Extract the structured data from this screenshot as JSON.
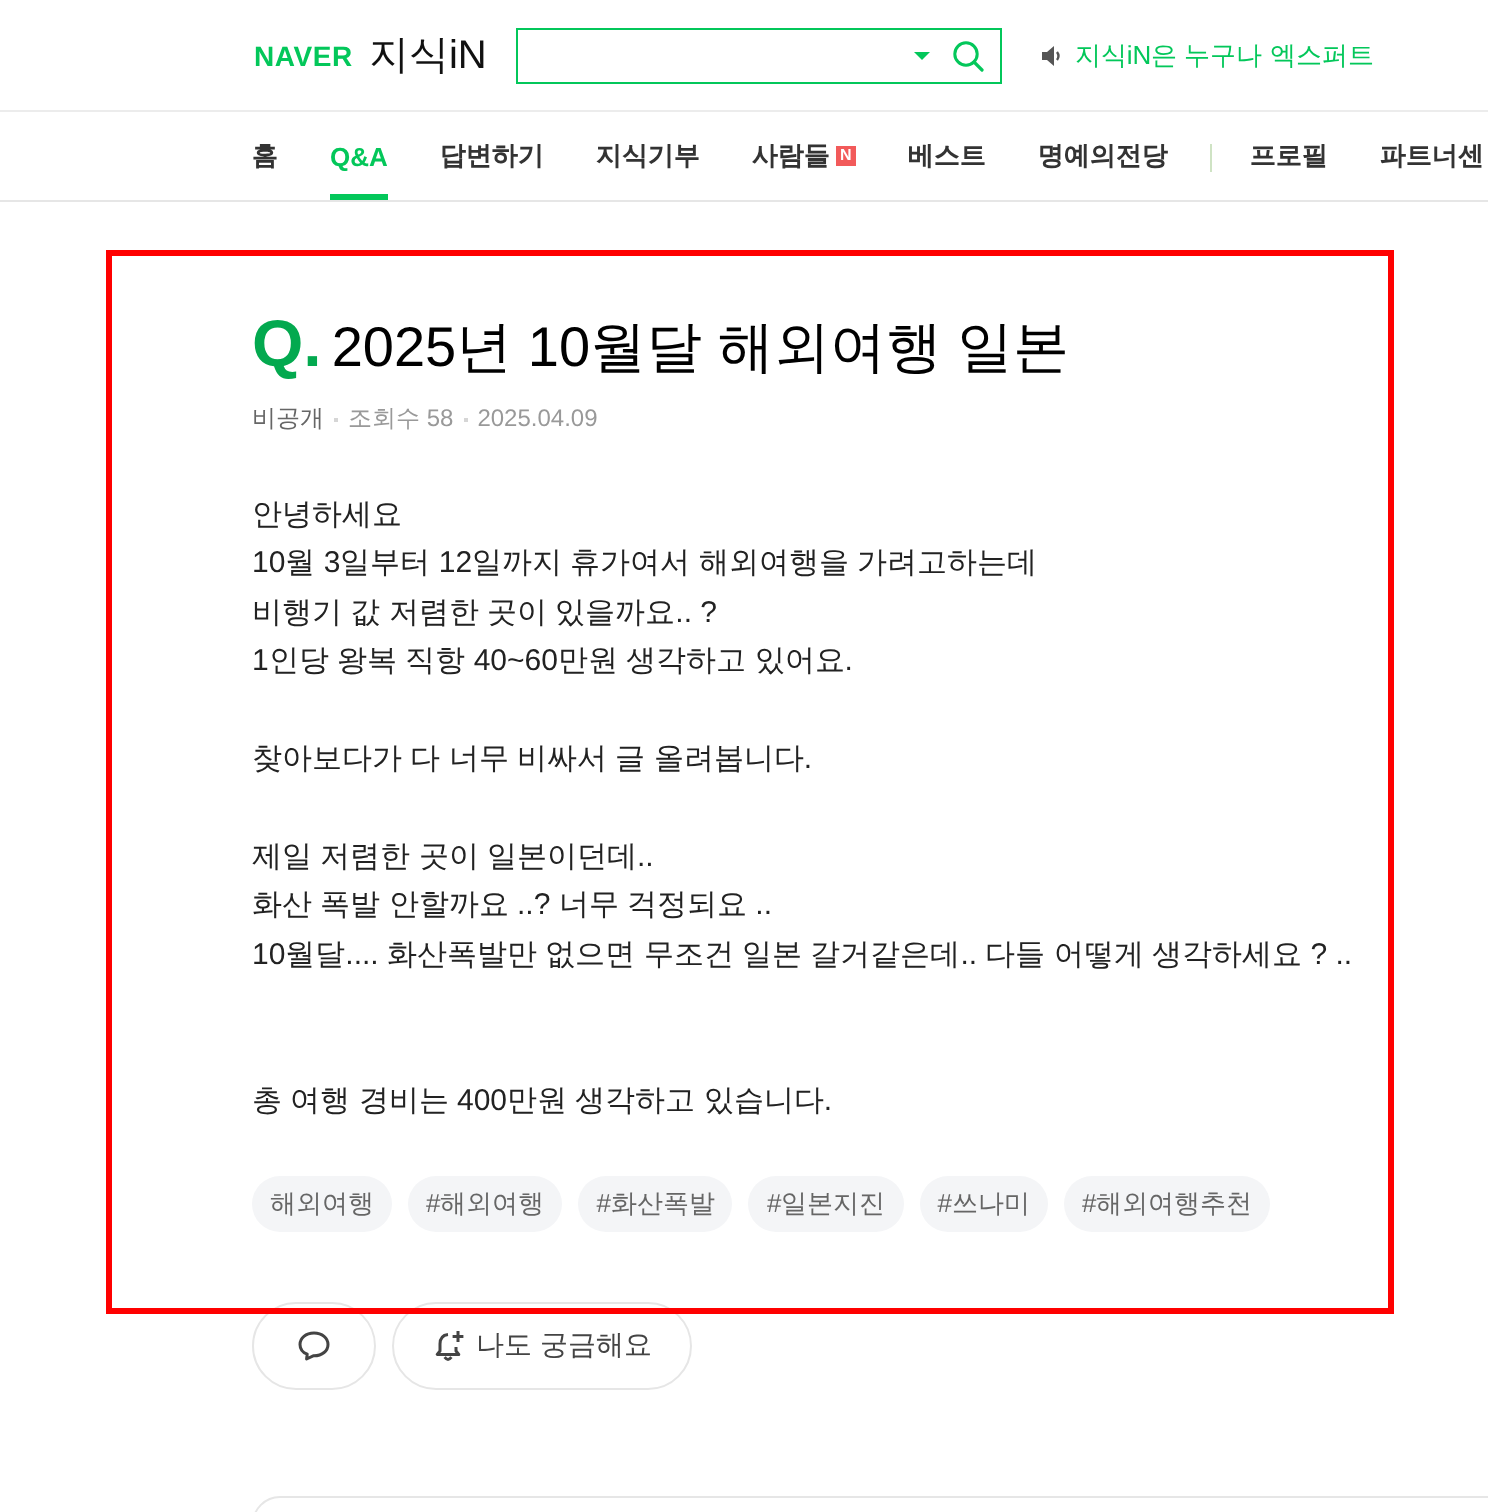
{
  "header": {
    "logo": "NAVER",
    "service": "지식iN",
    "notice": "지식iN은 누구나 엑스퍼트"
  },
  "nav": {
    "items": [
      {
        "label": "홈",
        "selected": false
      },
      {
        "label": "Q&A",
        "selected": true
      },
      {
        "label": "답변하기",
        "selected": false
      },
      {
        "label": "지식기부",
        "selected": false
      },
      {
        "label": "사람들",
        "selected": false,
        "badge": "N"
      },
      {
        "label": "베스트",
        "selected": false
      },
      {
        "label": "명예의전당",
        "selected": false
      }
    ],
    "extra_items": [
      {
        "label": "프로필",
        "selected": false
      },
      {
        "label": "파트너센",
        "selected": false
      }
    ]
  },
  "question": {
    "highlighted": true,
    "prefix": "Q.",
    "title": "2025년 10월달 해외여행 일본",
    "meta": {
      "visibility": "비공개",
      "views": "조회수 58",
      "date": "2025.04.09"
    },
    "body": "안녕하세요\n10월 3일부터 12일까지 휴가여서 해외여행을 가려고하는데\n비행기 값 저렴한 곳이 있을까요.. ?\n1인당 왕복 직항 40~60만원 생각하고 있어요.\n\n찾아보다가 다 너무 비싸서 글 올려봅니다.\n\n제일 저렴한 곳이 일본이던데..\n화산 폭발 안할까요 ..? 너무 걱정되요 ..\n10월달.... 화산폭발만 없으면 무조건 일본 갈거같은데.. 다들 어떻게 생각하세요 ? ..\n\n\n총 여행 경비는 400만원 생각하고 있습니다.",
    "tags": [
      "해외여행",
      "#해외여행",
      "#화산폭발",
      "#일본지진",
      "#쓰나미",
      "#해외여행추천"
    ],
    "actions": [
      {
        "kind": "comment"
      },
      {
        "kind": "curious",
        "label": "나도 궁금해요"
      }
    ]
  }
}
